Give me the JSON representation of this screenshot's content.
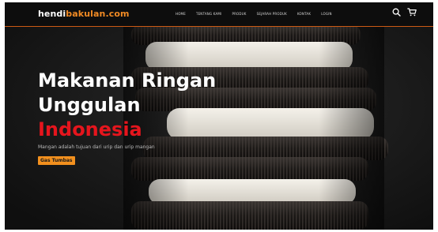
{
  "header": {
    "brand_main": "hendi",
    "brand_accent": "bakulan.com",
    "nav_items": [
      "HOME",
      "TENTANG KAMI",
      "PRODUK",
      "SEJARAH PRODUK",
      "KONTAK",
      "LOGIN"
    ],
    "search_icon": "search-icon",
    "cart_icon": "cart-icon"
  },
  "hero": {
    "title_line1": "Makanan Ringan",
    "title_line2": "Unggulan",
    "title_line3": "Indonesia",
    "subtitle": "Mangan adalah tujuan dari urip dan urip mangan",
    "cta_label": "Gas Tumbas"
  },
  "colors": {
    "accent_orange": "#f08a24",
    "headline_red": "#e5151d",
    "cta_bg": "#f2901e",
    "navbar_bg": "#0d0d0d",
    "hero_bg": "#151515"
  }
}
